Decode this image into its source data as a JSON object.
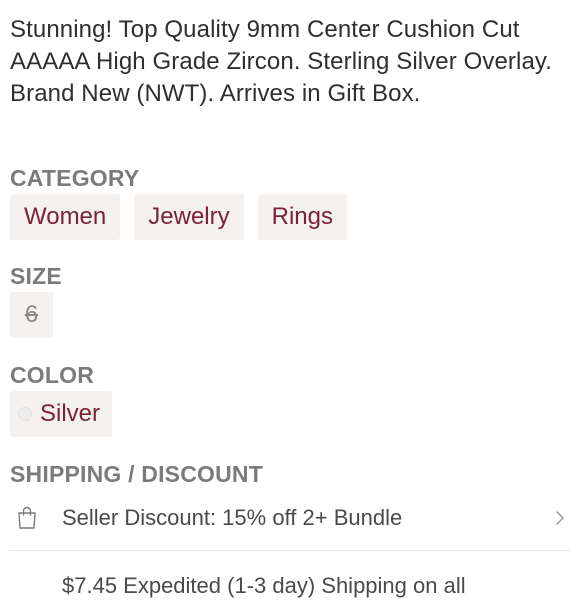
{
  "listing": {
    "description": "Stunning! Top Quality 9mm Center Cushion Cut AAAAA High Grade Zircon. Sterling Silver Overlay. Brand New (NWT). Arrives in Gift Box."
  },
  "category": {
    "heading": "CATEGORY",
    "chips": [
      {
        "label": "Women"
      },
      {
        "label": "Jewelry"
      },
      {
        "label": "Rings"
      }
    ]
  },
  "size": {
    "heading": "SIZE",
    "value": "6"
  },
  "color": {
    "heading": "COLOR",
    "value": "Silver",
    "swatch_color": "#ececec"
  },
  "shipping": {
    "heading": "SHIPPING / DISCOUNT",
    "seller_discount": "Seller Discount: 15% off 2+ Bundle",
    "expedited": "$7.45 Expedited (1-3 day) Shipping on all"
  },
  "colors": {
    "chip_background": "#f4f1ee",
    "chip_text": "#7a2333",
    "heading_text": "#7b7b7b",
    "body_text": "#2f2f2f"
  }
}
